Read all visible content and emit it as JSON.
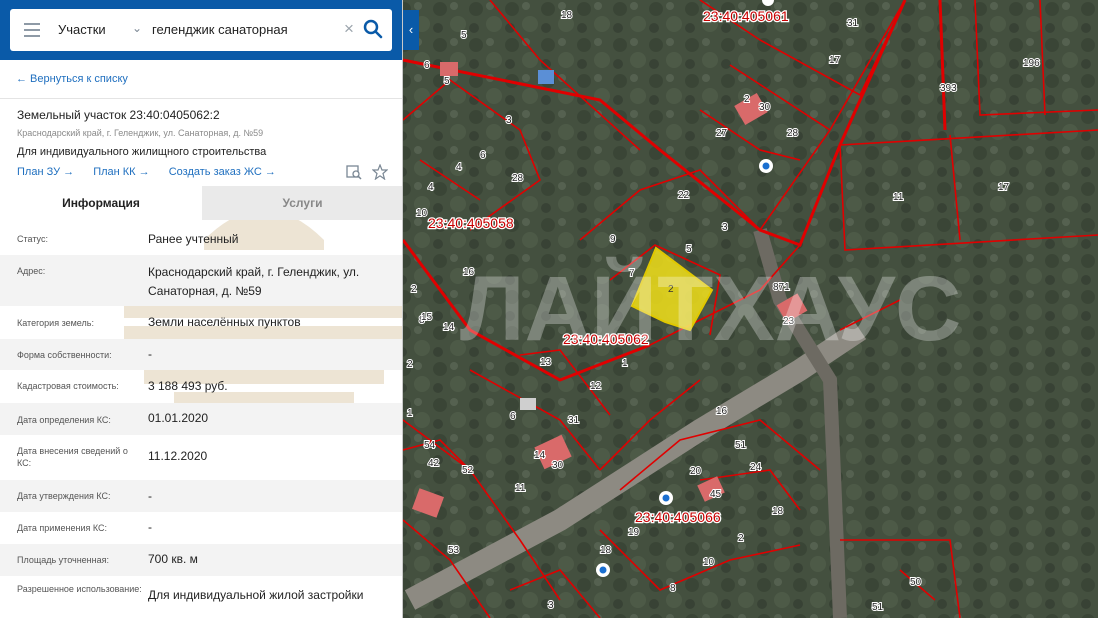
{
  "search": {
    "category": "Участки",
    "query": "геленджик санаторная"
  },
  "back_link": "← Вернуться к списку",
  "parcel": {
    "title": "Земельный участок 23:40:0405062:2",
    "address_short": "Краснодарский край, г. Геленджик, ул. Санаторная, д. №59",
    "purpose": "Для индивидуального жилищного строительства",
    "links": [
      "План ЗУ →",
      "План КК →",
      "Создать заказ ЖС →"
    ]
  },
  "tabs": [
    "Информация",
    "Услуги"
  ],
  "fields": [
    {
      "key": "Статус:",
      "value": "Ранее учтенный"
    },
    {
      "key": "Адрес:",
      "value": "Краснодарский край, г. Геленджик, ул. Санаторная, д. №59"
    },
    {
      "key": "Категория земель:",
      "value": "Земли населённых пунктов"
    },
    {
      "key": "Форма собственности:",
      "value": "-"
    },
    {
      "key": "Кадастровая стоимость:",
      "value": "3 188 493 руб."
    },
    {
      "key": "Дата определения КС:",
      "value": "01.01.2020"
    },
    {
      "key": "Дата внесения сведений о КС:",
      "value": "11.12.2020"
    },
    {
      "key": "Дата утверждения КС:",
      "value": "-"
    },
    {
      "key": "Дата применения КС:",
      "value": "-"
    },
    {
      "key": "Площадь уточненная:",
      "value": "700 кв. м"
    },
    {
      "key": "Разрешенное использование:",
      "value": "Для индивидуальной жилой застройки"
    }
  ],
  "map": {
    "watermark": "ЛАЙТХАУС",
    "quarters": [
      "23:40:405061",
      "23:40:405058",
      "23:40:405062",
      "23:40:405066"
    ],
    "plot_numbers": [
      "18",
      "5",
      "31",
      "17",
      "196",
      "393",
      "6",
      "5",
      "2",
      "30",
      "27",
      "28",
      "3",
      "4",
      "6",
      "28",
      "11",
      "17",
      "10",
      "9",
      "22",
      "3",
      "5",
      "7",
      "2",
      "871",
      "23",
      "16",
      "8",
      "14",
      "13",
      "1",
      "12",
      "16",
      "6",
      "31",
      "51",
      "24",
      "20",
      "45",
      "54",
      "52",
      "42",
      "14",
      "30",
      "11",
      "18",
      "53",
      "19",
      "2",
      "10",
      "18",
      "8",
      "3",
      "50",
      "51",
      "2",
      "4",
      "15",
      "1"
    ],
    "selected_plot": "2"
  },
  "colors": {
    "brand": "#0a5aa8",
    "parcel_border": "#e00000",
    "selected_fill": "#f2e01a",
    "link": "#1f6fbf"
  }
}
